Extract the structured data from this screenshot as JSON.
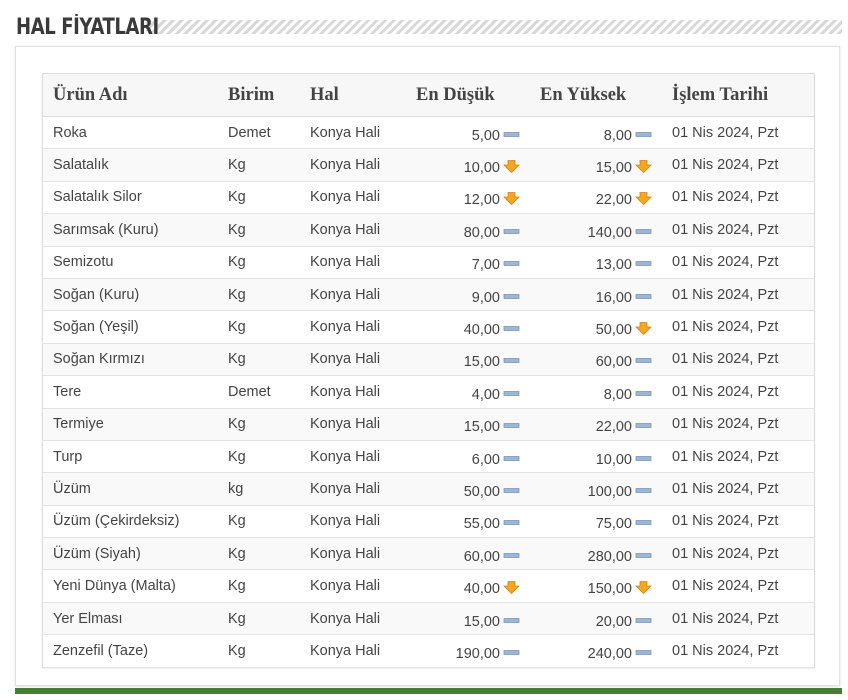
{
  "section": {
    "title": "HAL FİYATLARI"
  },
  "colors": {
    "accent_bar": "#4a7a37",
    "down_arrow": "#f5a623",
    "stable_bar": "#9db6d6"
  },
  "table": {
    "headers": [
      "Ürün Adı",
      "Birim",
      "Hal",
      "En Düşük",
      "En Yüksek",
      "İşlem Tarihi"
    ],
    "rows": [
      {
        "name": "Roka",
        "unit": "Demet",
        "market": "Konya Hali",
        "low": "5,00",
        "low_icon": "stable-icon",
        "high": "8,00",
        "high_icon": "stable-icon",
        "date": "01 Nis 2024, Pzt"
      },
      {
        "name": "Salatalık",
        "unit": "Kg",
        "market": "Konya Hali",
        "low": "10,00",
        "low_icon": "down-arrow-icon",
        "high": "15,00",
        "high_icon": "down-arrow-icon",
        "date": "01 Nis 2024, Pzt"
      },
      {
        "name": "Salatalık Silor",
        "unit": "Kg",
        "market": "Konya Hali",
        "low": "12,00",
        "low_icon": "down-arrow-icon",
        "high": "22,00",
        "high_icon": "down-arrow-icon",
        "date": "01 Nis 2024, Pzt"
      },
      {
        "name": "Sarımsak (Kuru)",
        "unit": "Kg",
        "market": "Konya Hali",
        "low": "80,00",
        "low_icon": "stable-icon",
        "high": "140,00",
        "high_icon": "stable-icon",
        "date": "01 Nis 2024, Pzt"
      },
      {
        "name": "Semizotu",
        "unit": "Kg",
        "market": "Konya Hali",
        "low": "7,00",
        "low_icon": "stable-icon",
        "high": "13,00",
        "high_icon": "stable-icon",
        "date": "01 Nis 2024, Pzt"
      },
      {
        "name": "Soğan (Kuru)",
        "unit": "Kg",
        "market": "Konya Hali",
        "low": "9,00",
        "low_icon": "stable-icon",
        "high": "16,00",
        "high_icon": "stable-icon",
        "date": "01 Nis 2024, Pzt"
      },
      {
        "name": "Soğan (Yeşil)",
        "unit": "Kg",
        "market": "Konya Hali",
        "low": "40,00",
        "low_icon": "stable-icon",
        "high": "50,00",
        "high_icon": "down-arrow-icon",
        "date": "01 Nis 2024, Pzt"
      },
      {
        "name": "Soğan Kırmızı",
        "unit": "Kg",
        "market": "Konya Hali",
        "low": "15,00",
        "low_icon": "stable-icon",
        "high": "60,00",
        "high_icon": "stable-icon",
        "date": "01 Nis 2024, Pzt"
      },
      {
        "name": "Tere",
        "unit": "Demet",
        "market": "Konya Hali",
        "low": "4,00",
        "low_icon": "stable-icon",
        "high": "8,00",
        "high_icon": "stable-icon",
        "date": "01 Nis 2024, Pzt"
      },
      {
        "name": "Termiye",
        "unit": "Kg",
        "market": "Konya Hali",
        "low": "15,00",
        "low_icon": "stable-icon",
        "high": "22,00",
        "high_icon": "stable-icon",
        "date": "01 Nis 2024, Pzt"
      },
      {
        "name": "Turp",
        "unit": "Kg",
        "market": "Konya Hali",
        "low": "6,00",
        "low_icon": "stable-icon",
        "high": "10,00",
        "high_icon": "stable-icon",
        "date": "01 Nis 2024, Pzt"
      },
      {
        "name": "Üzüm",
        "unit": "kg",
        "market": "Konya Hali",
        "low": "50,00",
        "low_icon": "stable-icon",
        "high": "100,00",
        "high_icon": "stable-icon",
        "date": "01 Nis 2024, Pzt"
      },
      {
        "name": "Üzüm (Çekirdeksiz)",
        "unit": "Kg",
        "market": "Konya Hali",
        "low": "55,00",
        "low_icon": "stable-icon",
        "high": "75,00",
        "high_icon": "stable-icon",
        "date": "01 Nis 2024, Pzt"
      },
      {
        "name": "Üzüm (Siyah)",
        "unit": "Kg",
        "market": "Konya Hali",
        "low": "60,00",
        "low_icon": "stable-icon",
        "high": "280,00",
        "high_icon": "stable-icon",
        "date": "01 Nis 2024, Pzt"
      },
      {
        "name": "Yeni Dünya (Malta)",
        "unit": "Kg",
        "market": "Konya Hali",
        "low": "40,00",
        "low_icon": "down-arrow-icon",
        "high": "150,00",
        "high_icon": "down-arrow-icon",
        "date": "01 Nis 2024, Pzt"
      },
      {
        "name": "Yer Elması",
        "unit": "Kg",
        "market": "Konya Hali",
        "low": "15,00",
        "low_icon": "stable-icon",
        "high": "20,00",
        "high_icon": "stable-icon",
        "date": "01 Nis 2024, Pzt"
      },
      {
        "name": "Zenzefil (Taze)",
        "unit": "Kg",
        "market": "Konya Hali",
        "low": "190,00",
        "low_icon": "stable-icon",
        "high": "240,00",
        "high_icon": "stable-icon",
        "date": "01 Nis 2024, Pzt"
      }
    ]
  }
}
